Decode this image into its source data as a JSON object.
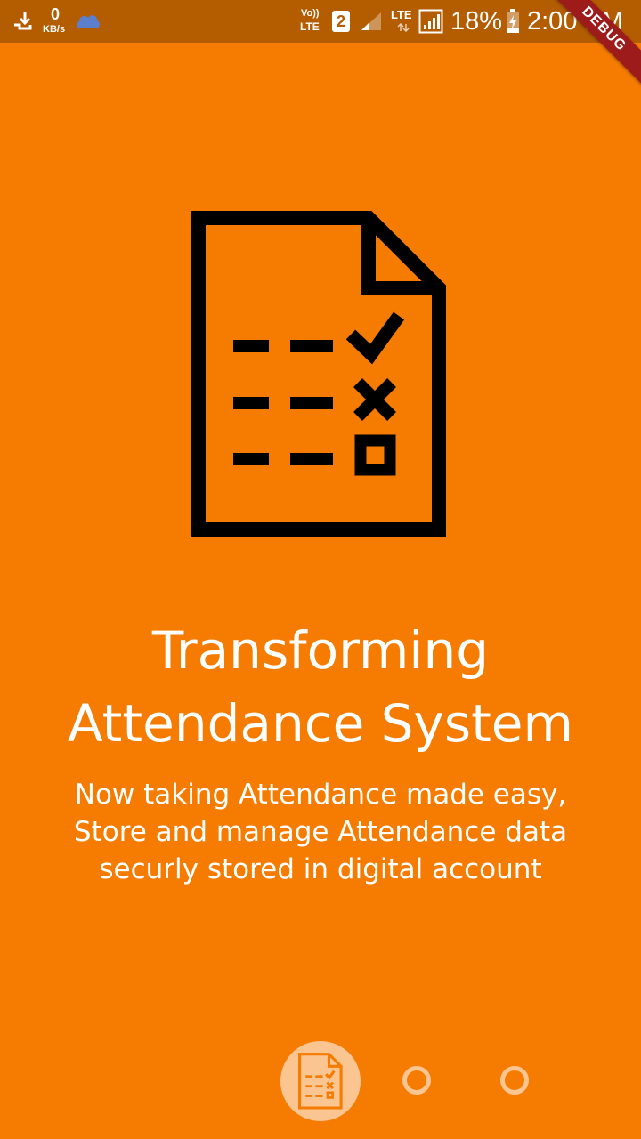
{
  "status_bar": {
    "net_speed_value": "0",
    "net_speed_unit": "KB/s",
    "volte_top": "Vo))",
    "volte_bottom": "LTE",
    "sim_badge": "2",
    "lte_label": "LTE",
    "battery_percent": "18%",
    "time": "2:00 PM"
  },
  "debug_banner": {
    "label": "DEBUG"
  },
  "onboarding": {
    "icon": "checklist-document-icon",
    "title_line1": "Transforming",
    "title_line2": "Attendance System",
    "description_line1": "Now taking Attendance made easy,",
    "description_line2": "Store and manage Attendance data",
    "description_line3": "securly stored in digital account"
  },
  "pager": {
    "total_pages": 3,
    "active_page": 1,
    "active_icon": "checklist-document-icon"
  },
  "colors": {
    "background": "#F57C00",
    "status_bar": "#B35C00",
    "indicator": "#FBC592",
    "debug_ribbon": "#9E1B1B"
  }
}
